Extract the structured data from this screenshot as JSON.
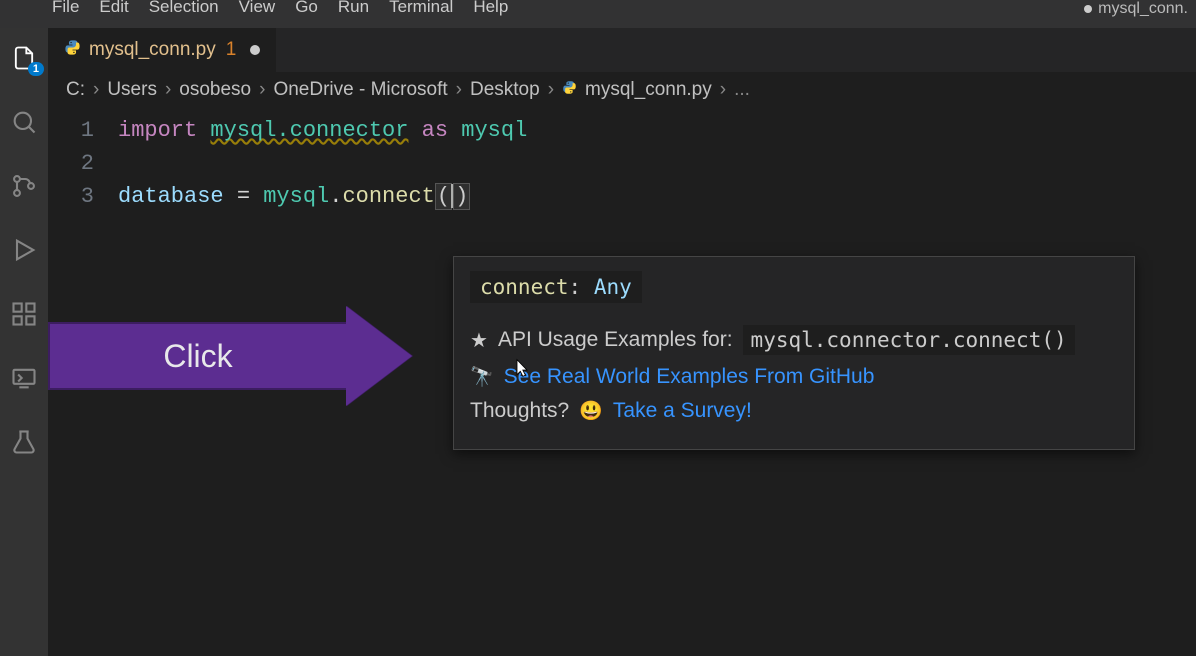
{
  "menu": {
    "items": [
      "File",
      "Edit",
      "Selection",
      "View",
      "Go",
      "Run",
      "Terminal",
      "Help"
    ],
    "title_right": "mysql_conn."
  },
  "activitybar": {
    "explorer_badge": "1"
  },
  "tab": {
    "filename": "mysql_conn.py",
    "badge": "1"
  },
  "breadcrumbs": {
    "parts": [
      "C:",
      "Users",
      "osobeso",
      "OneDrive - Microsoft",
      "Desktop",
      "mysql_conn.py"
    ],
    "trailing": "..."
  },
  "code": {
    "lines": [
      {
        "n": "1",
        "segments": [
          {
            "t": "import ",
            "c": "kw"
          },
          {
            "t": "mysql.connector",
            "c": "mod"
          },
          {
            "t": " as ",
            "c": "kw"
          },
          {
            "t": "mysql",
            "c": "pkg"
          }
        ]
      },
      {
        "n": "2",
        "segments": []
      },
      {
        "n": "3",
        "segments": [
          {
            "t": "database",
            "c": "ident"
          },
          {
            "t": " = ",
            "c": "op"
          },
          {
            "t": "mysql",
            "c": "pkg"
          },
          {
            "t": ".",
            "c": "op"
          },
          {
            "t": "connect",
            "c": "fn"
          },
          {
            "t": "(",
            "c": "paren"
          },
          {
            "t": ")",
            "c": "paren"
          }
        ]
      }
    ]
  },
  "hover": {
    "signature_name": "connect",
    "signature_colon": ": ",
    "signature_type": "Any",
    "api_prefix": "API Usage Examples for:",
    "api_code": "mysql.connector.connect()",
    "github_link": "See Real World Examples From GitHub",
    "thoughts_label": "Thoughts?",
    "survey_link": "Take a Survey!"
  },
  "annotation": {
    "arrow_text": "Click"
  }
}
